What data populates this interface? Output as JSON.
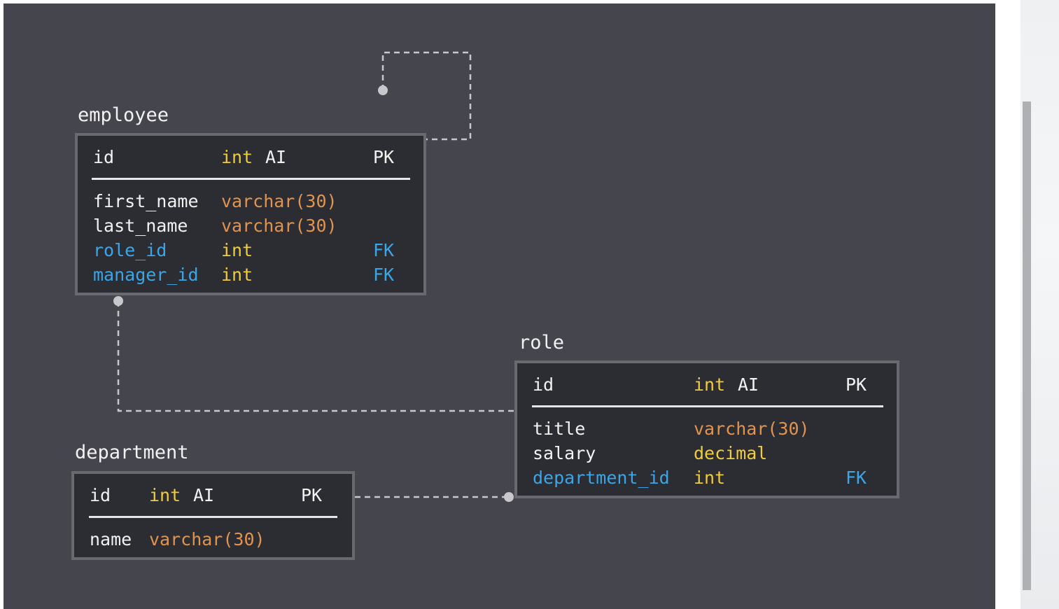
{
  "colors": {
    "background": "#45454d",
    "table_fill": "#2c2c33",
    "table_border": "#696970",
    "text": "#f2f2f2",
    "varchar_type": "#e0944f",
    "numeric_type": "#f0cb3a",
    "foreign_key": "#3aa6e8",
    "connector": "#c8c8cc"
  },
  "tables": {
    "employee": {
      "name": "employee",
      "pk": {
        "field": "id",
        "type": "int",
        "extra": "AI",
        "key": "PK"
      },
      "fields": [
        {
          "field": "first_name",
          "type": "varchar(30)",
          "key": ""
        },
        {
          "field": "last_name",
          "type": "varchar(30)",
          "key": ""
        },
        {
          "field": "role_id",
          "type": "int",
          "key": "FK"
        },
        {
          "field": "manager_id",
          "type": "int",
          "key": "FK"
        }
      ]
    },
    "role": {
      "name": "role",
      "pk": {
        "field": "id",
        "type": "int",
        "extra": "AI",
        "key": "PK"
      },
      "fields": [
        {
          "field": "title",
          "type": "varchar(30)",
          "key": ""
        },
        {
          "field": "salary",
          "type": "decimal",
          "key": ""
        },
        {
          "field": "department_id",
          "type": "int",
          "key": "FK"
        }
      ]
    },
    "department": {
      "name": "department",
      "pk": {
        "field": "id",
        "type": "int",
        "extra": "AI",
        "key": "PK"
      },
      "fields": [
        {
          "field": "name",
          "type": "varchar(30)",
          "key": ""
        }
      ]
    }
  },
  "relationships": [
    {
      "from": "employee.manager_id",
      "to": "employee.id",
      "style": "dashed"
    },
    {
      "from": "employee.role_id",
      "to": "role.id",
      "style": "dashed"
    },
    {
      "from": "role.department_id",
      "to": "department.id",
      "style": "dashed"
    }
  ]
}
